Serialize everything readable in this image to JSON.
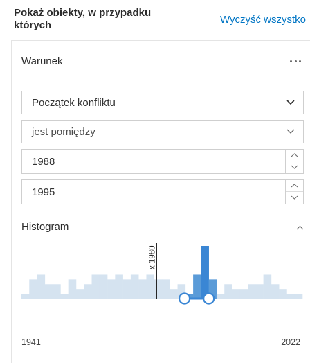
{
  "header": {
    "title": "Pokaż obiekty, w przypadku których",
    "clear_all": "Wyczyść wszystko"
  },
  "condition": {
    "label": "Warunek",
    "more_icon": "more-horizontal-icon",
    "field": "Początek konfliktu",
    "operator": "jest pomiędzy",
    "value_from": "1988",
    "value_to": "1995"
  },
  "histogram": {
    "label": "Histogram",
    "collapse_icon": "chevron-up-icon",
    "min_label": "1941",
    "max_label": "2022",
    "mean_label": "x̄ 1980",
    "colors": {
      "bar": "#d5e3f0",
      "selected": "#5a9bd8",
      "highlight": "#3a86d4",
      "axis": "#999999",
      "handle": "#3a86d4"
    }
  },
  "chart_data": {
    "type": "bar",
    "x_range": [
      1941,
      2022
    ],
    "mean": 1980,
    "selected_range": [
      1988,
      1995
    ],
    "relative_counts": [
      1,
      4,
      5,
      3,
      3,
      1,
      4,
      2,
      3,
      5,
      5,
      4,
      5,
      4,
      5,
      4,
      5,
      4,
      4,
      2,
      3,
      1,
      5,
      11,
      4,
      1,
      3,
      2,
      2,
      3,
      3,
      5,
      3,
      2,
      1,
      1
    ],
    "selected_indices": [
      21,
      22,
      23,
      24
    ]
  }
}
